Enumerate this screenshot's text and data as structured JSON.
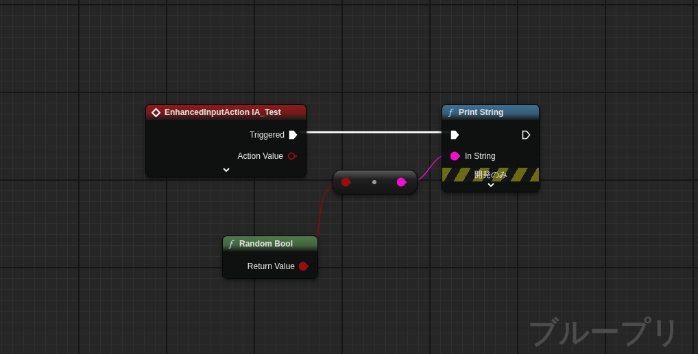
{
  "nodes": [
    {
      "kind": "event",
      "title": "EnhancedInputAction IA_Test",
      "color": "#8a1c1c",
      "expanded": false,
      "outputs": [
        {
          "kind": "exec",
          "label": "Triggered",
          "connected": true
        },
        {
          "kind": "data",
          "label": "Action Value",
          "connected": false,
          "color": "#9a0e0e"
        }
      ]
    },
    {
      "kind": "function",
      "title": "Print String",
      "color": "#3f6f92",
      "expanded": false,
      "development_label": "開発のみ",
      "inputs": [
        {
          "kind": "exec",
          "connected": true
        },
        {
          "kind": "data",
          "label": "In String",
          "connected": true,
          "color": "#f010d0"
        }
      ],
      "outputs": [
        {
          "kind": "exec",
          "connected": false
        }
      ]
    },
    {
      "kind": "conversion",
      "inputs": [
        {
          "kind": "data",
          "connected": true,
          "color": "#9a0e0e"
        }
      ],
      "outputs": [
        {
          "kind": "data",
          "connected": true,
          "color": "#f010d0"
        }
      ]
    },
    {
      "kind": "function",
      "title": "Random Bool",
      "color": "#4f7a4a",
      "outputs": [
        {
          "kind": "data",
          "label": "Return Value",
          "connected": true,
          "color": "#9a0e0e"
        }
      ]
    }
  ],
  "graph_label": "ブループリ"
}
